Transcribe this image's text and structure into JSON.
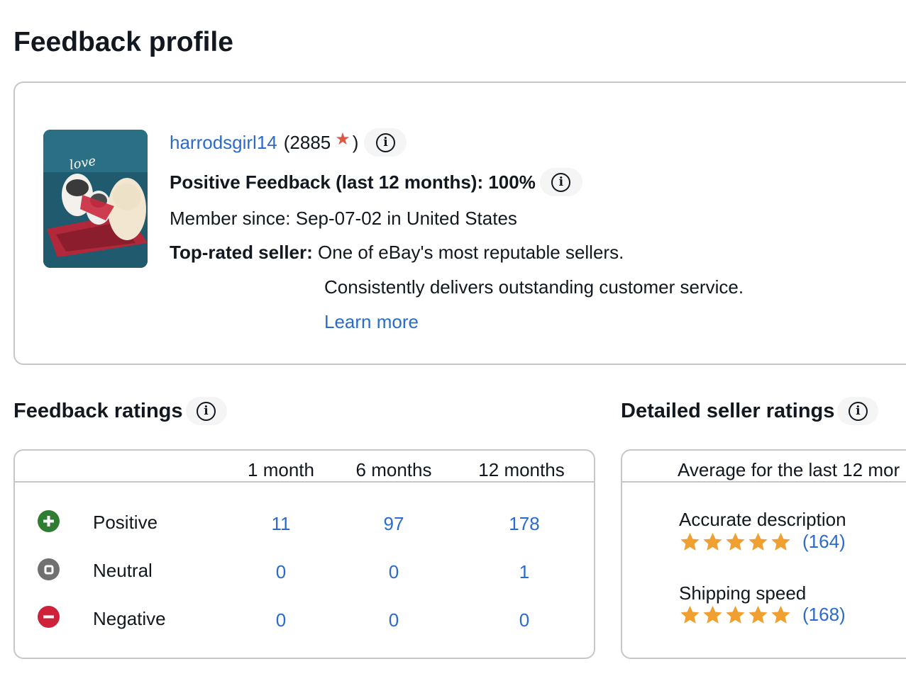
{
  "page": {
    "title": "Feedback profile"
  },
  "profile": {
    "username": "harrodsgirl14",
    "score_open": "(2885",
    "score_close": ")",
    "positive_feedback": "Positive Feedback (last 12 months): 100%",
    "member_since": "Member since: Sep-07-02 in United States",
    "top_rated_label": "Top-rated seller:",
    "top_rated_desc_1": "One of eBay's most reputable sellers.",
    "top_rated_desc_2": "Consistently delivers outstanding customer service.",
    "learn_more": "Learn more",
    "avatar_text": "love",
    "star_color": "#dc5a42"
  },
  "feedback_ratings": {
    "title": "Feedback ratings",
    "columns": [
      "1 month",
      "6 months",
      "12 months"
    ],
    "rows": [
      {
        "label": "Positive",
        "icon": "plus-circle-icon",
        "color": "#2e7d32",
        "values": [
          "11",
          "97",
          "178"
        ]
      },
      {
        "label": "Neutral",
        "icon": "square-circle-icon",
        "color": "#707070",
        "values": [
          "0",
          "0",
          "1"
        ]
      },
      {
        "label": "Negative",
        "icon": "minus-circle-icon",
        "color": "#d0213a",
        "values": [
          "0",
          "0",
          "0"
        ]
      }
    ]
  },
  "detailed_ratings": {
    "title": "Detailed seller ratings",
    "header": "Average for the last 12 mor",
    "items": [
      {
        "name": "Accurate description",
        "stars": 5,
        "count": "(164)"
      },
      {
        "name": "Shipping speed",
        "stars": 5,
        "count": "(168)"
      }
    ],
    "star_color": "#f0a030"
  },
  "colors": {
    "link": "#2a6ccb",
    "border": "#c7c7c7",
    "text": "#111820"
  }
}
